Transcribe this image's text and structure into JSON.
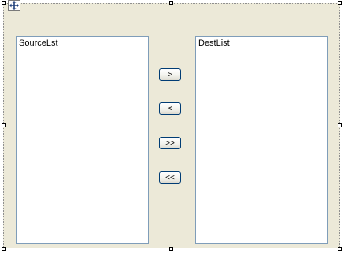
{
  "source_list": {
    "items": [
      "SourceLst"
    ]
  },
  "dest_list": {
    "items": [
      "DestList"
    ]
  },
  "buttons": {
    "move_right": ">",
    "move_left": "<",
    "move_all_right": ">>",
    "move_all_left": "<<"
  },
  "icons": {
    "move_glyph": "four-way-arrow-icon",
    "selection_grip": "resize-handle-icon"
  },
  "colors": {
    "form_background": "#ece9d8",
    "listbox_border": "#7f9db9",
    "button_border": "#003c74"
  }
}
